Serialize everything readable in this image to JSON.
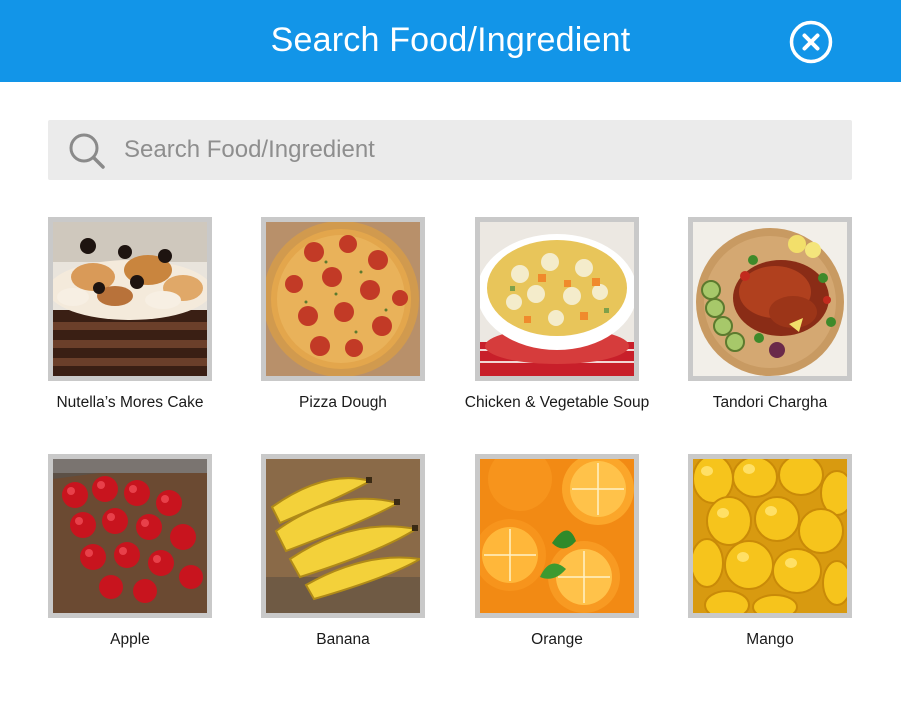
{
  "header": {
    "title": "Search Food/Ingredient",
    "background_color": "#1295e8",
    "close_icon": "close-circle-icon"
  },
  "search": {
    "placeholder": "Search Food/Ingredient",
    "value": "",
    "icon": "search-icon"
  },
  "foods": [
    {
      "label": "Nutella’s Mores Cake",
      "image": "cake-image"
    },
    {
      "label": "Pizza Dough",
      "image": "pizza-image"
    },
    {
      "label": "Chicken & Vegetable Soup",
      "image": "soup-image"
    },
    {
      "label": "Tandori Chargha",
      "image": "chicken-image"
    },
    {
      "label": "Apple",
      "image": "apple-image"
    },
    {
      "label": "Banana",
      "image": "banana-image"
    },
    {
      "label": "Orange",
      "image": "orange-image"
    },
    {
      "label": "Mango",
      "image": "mango-image"
    }
  ]
}
